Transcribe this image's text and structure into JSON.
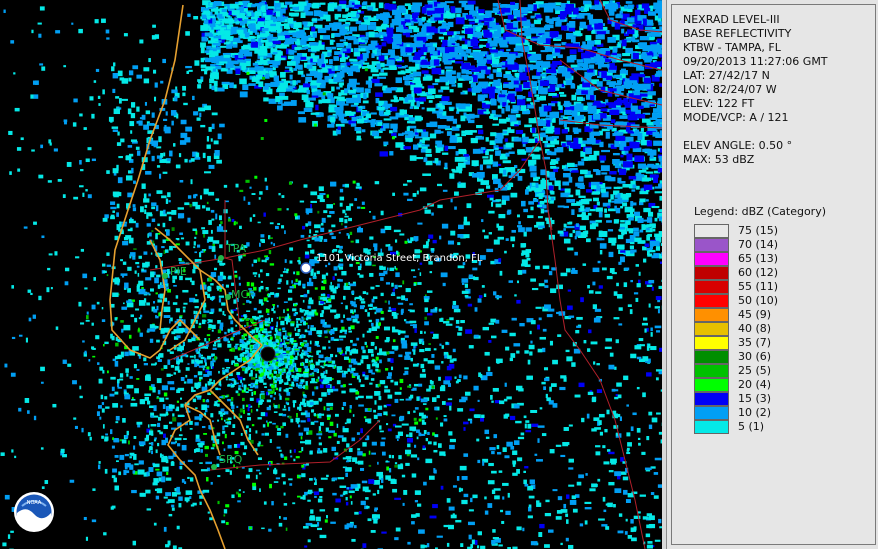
{
  "info": {
    "product": "NEXRAD LEVEL-III",
    "product_type": "BASE REFLECTIVITY",
    "station": "KTBW - TAMPA, FL",
    "datetime": "09/20/2013 11:27:06 GMT",
    "lat": "LAT: 27/42/17 N",
    "lon": "LON: 82/24/07 W",
    "elev": "ELEV: 122 FT",
    "mode_vcp": "MODE/VCP: A / 121",
    "elev_angle": "ELEV ANGLE: 0.50 °",
    "max": "MAX: 53 dBZ"
  },
  "legend": {
    "title": "Legend: dBZ (Category)",
    "items": [
      {
        "label": "75  (15)",
        "color": "#e8e8e8"
      },
      {
        "label": "70  (14)",
        "color": "#9a55c9"
      },
      {
        "label": "65  (13)",
        "color": "#ff00ff"
      },
      {
        "label": "60  (12)",
        "color": "#c00000"
      },
      {
        "label": "55  (11)",
        "color": "#d80000"
      },
      {
        "label": "50  (10)",
        "color": "#ff0000"
      },
      {
        "label": "45  (9)",
        "color": "#ff9000"
      },
      {
        "label": "40  (8)",
        "color": "#e7c000"
      },
      {
        "label": "35  (7)",
        "color": "#ffff00"
      },
      {
        "label": "30  (6)",
        "color": "#008e00"
      },
      {
        "label": "25  (5)",
        "color": "#00c000"
      },
      {
        "label": "20  (4)",
        "color": "#00ff00"
      },
      {
        "label": "15  (3)",
        "color": "#0000f6"
      },
      {
        "label": "10  (2)",
        "color": "#019ff4"
      },
      {
        "label": "5  (1)",
        "color": "#04e9e7"
      }
    ]
  },
  "map": {
    "marker_label": "1101 Victoria Street, Brandon, FL",
    "cities": [
      {
        "label": "TPA"
      },
      {
        "label": "PIE"
      },
      {
        "label": "MCF"
      },
      {
        "label": "SRQ"
      }
    ],
    "logo": "NOAA",
    "colors": {
      "county_lines": "#b0202a",
      "coastline": "#e6a030",
      "background": "#000000"
    }
  }
}
